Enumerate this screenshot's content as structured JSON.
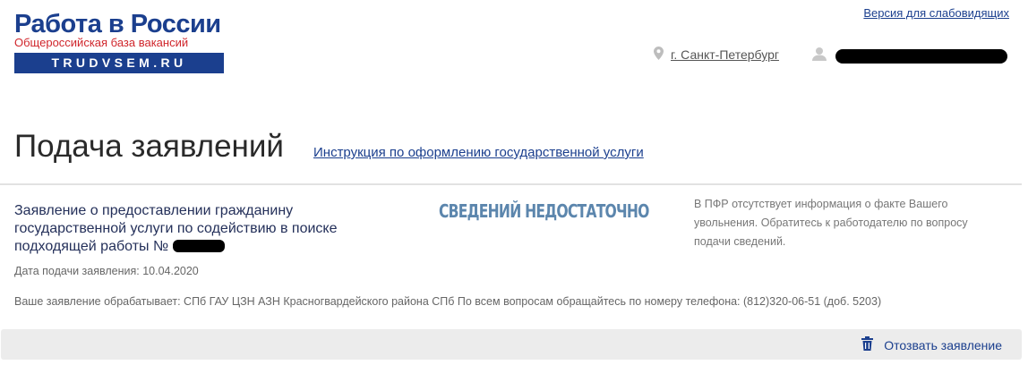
{
  "header": {
    "logo": {
      "title": "Работа в России",
      "subtitle": "Общероссийская база вакансий",
      "domain": "TRUDVSEM.RU"
    },
    "accessibility_link": "Версия для слабовидящих",
    "city": "г. Санкт-Петербург",
    "icons": {
      "location": "map-pin-icon",
      "user": "user-icon"
    }
  },
  "page": {
    "title": "Подача заявлений",
    "instruction_link": "Инструкция по оформлению государственной услуги"
  },
  "application": {
    "title": "Заявление о предоставлении гражданину государственной услуги по содействию в поиске подходящей работы №",
    "status": "СВЕДЕНИЙ НЕДОСТАТОЧНО",
    "status_color": "#5c86ad",
    "pfr_note": "В ПФР отсутствует информация о факте Вашего увольнения. Обратитесь к работодателю по вопросу подачи сведений.",
    "date_label": "Дата подачи заявления: 10.04.2020",
    "processor": "Ваше заявление обрабатывает: СПб ГАУ ЦЗН АЗН Красногвардейского района СПб  По всем вопросам обращайтесь по номеру телефона: (812)320-06-51 (доб. 5203)"
  },
  "footer": {
    "withdraw_label": "Отозвать заявление",
    "withdraw_icon": "trash-icon"
  },
  "colors": {
    "brand": "#1b3f8e",
    "logo_sub": "#d0262c",
    "footer_bg": "#ececec"
  }
}
